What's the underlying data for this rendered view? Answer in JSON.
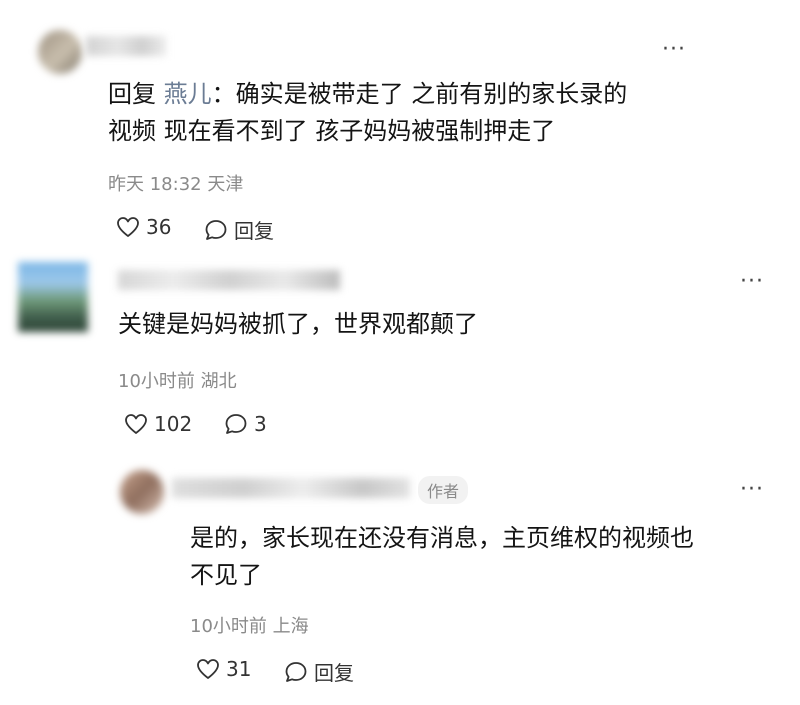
{
  "comments": [
    {
      "reply_prefix": "回复 ",
      "reply_to": "燕儿",
      "reply_sep": "：",
      "text_line1": "确实是被带走了 之前有别的家长录的",
      "text_line2": "视频 现在看不到了 孩子妈妈被强制押走了",
      "time": "昨天 18:32",
      "location": "天津",
      "likes": "36",
      "reply_label": "回复",
      "more_icon": "ellipsis-icon"
    },
    {
      "text": "关键是妈妈被抓了，世界观都颠了",
      "time": "10小时前",
      "location": "湖北",
      "likes": "102",
      "replies": "3",
      "more_icon": "ellipsis-icon"
    },
    {
      "author_tag": "作者",
      "text_line1": "是的，家长现在还没有消息，主页维权的视频也",
      "text_line2": "不见了",
      "time": "10小时前",
      "location": "上海",
      "likes": "31",
      "reply_label": "回复",
      "more_icon": "ellipsis-icon"
    }
  ]
}
